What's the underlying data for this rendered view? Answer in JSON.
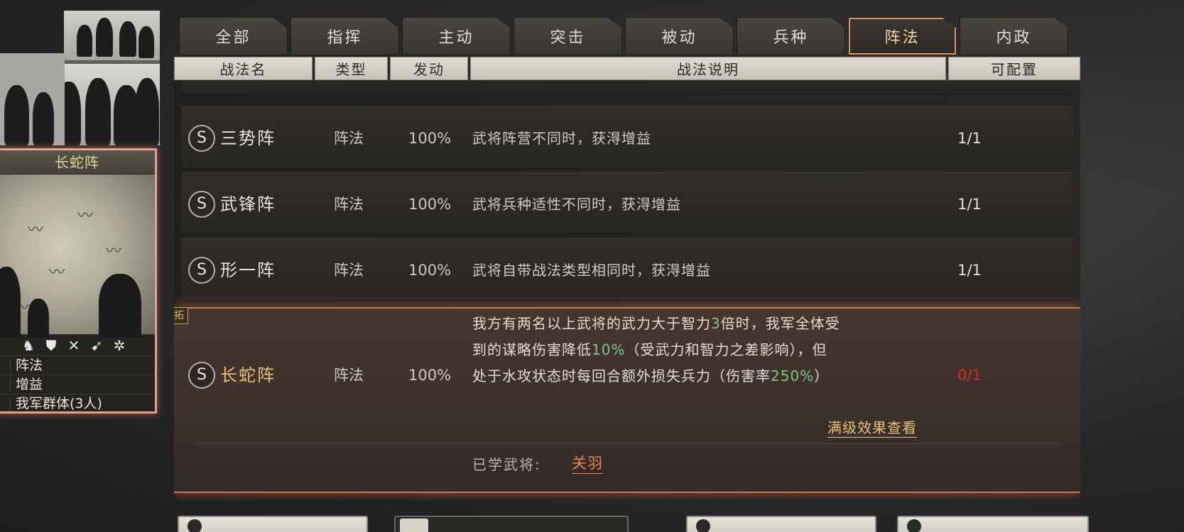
{
  "tabs": [
    {
      "label": "全部"
    },
    {
      "label": "指挥"
    },
    {
      "label": "主动"
    },
    {
      "label": "突击"
    },
    {
      "label": "被动"
    },
    {
      "label": "兵种"
    },
    {
      "label": "阵法",
      "active": true
    },
    {
      "label": "内政"
    }
  ],
  "columns": {
    "name": "战法名",
    "type": "类型",
    "trigger": "发动",
    "desc": "战法说明",
    "config": "可配置"
  },
  "rows": [
    {
      "grade": "S",
      "name": "三势阵",
      "type": "阵法",
      "rate": "100%",
      "desc": "武将阵营不同时，获淂增益",
      "count": "1/1"
    },
    {
      "grade": "S",
      "name": "武锋阵",
      "type": "阵法",
      "rate": "100%",
      "desc": "武将兵种适性不同时，获淂增益",
      "count": "1/1"
    },
    {
      "grade": "S",
      "name": "形一阵",
      "type": "阵法",
      "rate": "100%",
      "desc": "武将自带战法类型相同时，获淂增益",
      "count": "1/1"
    }
  ],
  "expanded": {
    "badge": "拓",
    "grade": "S",
    "name": "长蛇阵",
    "type": "阵法",
    "rate": "100%",
    "desc_line1_a": "我方有两名以上武将的武力大于智力",
    "desc_line1_hl": "3",
    "desc_line1_b": "倍时，我军全体受",
    "desc_line2_a": "到的谋略伤害降低",
    "desc_line2_hl": "10%",
    "desc_line2_b": "（受武力和智力之差影响），但",
    "desc_line3_a": "处于水攻状态时每回合额外损失兵力（伤害率",
    "desc_line3_hl": "250%",
    "desc_line3_b": "）",
    "count": "0/1",
    "full_effect_label": "满级效果查看",
    "learned_label": "已学武将:",
    "learned_value": "关羽"
  },
  "card": {
    "title": "长蛇阵",
    "icons": [
      "horse-icon",
      "shield-icon",
      "bow-icon",
      "spear-icon",
      "wheel-icon"
    ],
    "icon_glyphs": [
      "♞",
      "⛊",
      "✕",
      "➹",
      "✲"
    ],
    "type": "阵法",
    "effect": "增益",
    "target": "我军群体(3人)"
  },
  "colors": {
    "accent_orange": "#d88852",
    "highlight_green": "#7fc68f",
    "count_red": "#d12c22",
    "gold_text": "#e8c07a"
  }
}
